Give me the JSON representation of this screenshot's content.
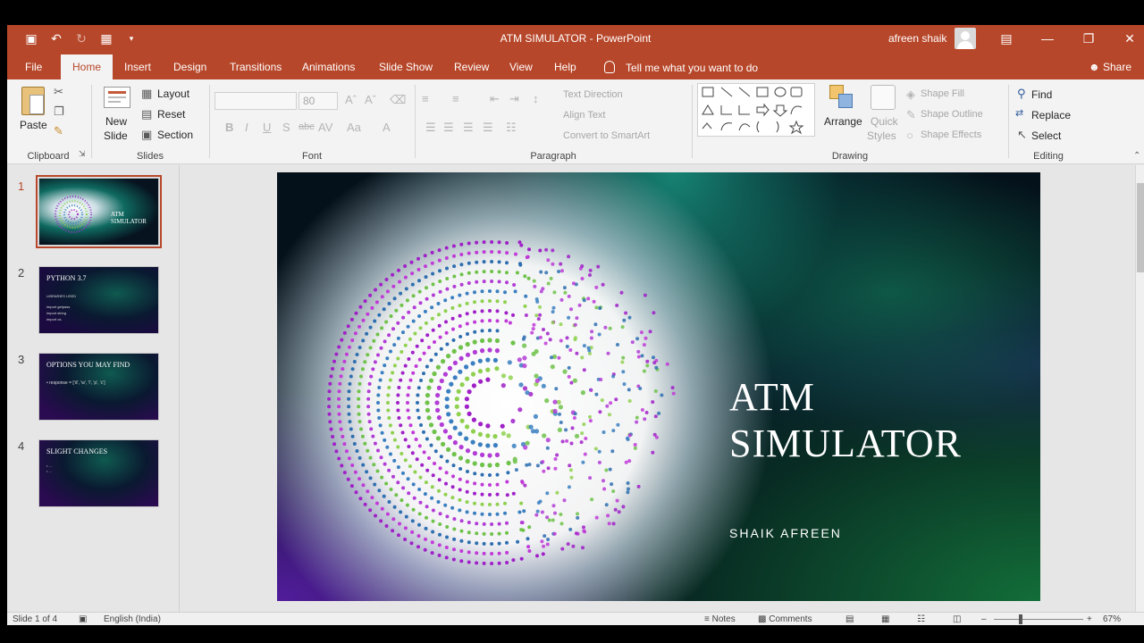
{
  "window": {
    "title": "ATM SIMULATOR  -  PowerPoint",
    "user": "afreen shaik",
    "accent": "#b7472a"
  },
  "qat": [
    "save-icon",
    "undo-icon",
    "redo-icon",
    "start-from-beginning-icon",
    "customize-icon"
  ],
  "tabs": [
    "File",
    "Home",
    "Insert",
    "Design",
    "Transitions",
    "Animations",
    "Slide Show",
    "Review",
    "View",
    "Help"
  ],
  "tell_me": "Tell me what you want to do",
  "share": "Share",
  "ribbon": {
    "clipboard": {
      "label": "Clipboard",
      "paste": "Paste"
    },
    "slides": {
      "label": "Slides",
      "new_slide_1": "New",
      "new_slide_2": "Slide",
      "layout": "Layout",
      "reset": "Reset",
      "section": "Section"
    },
    "font": {
      "label": "Font",
      "size": "80",
      "bold": "B",
      "italic": "I",
      "underline": "U",
      "shadow": "S",
      "strike": "abc",
      "spacing": "AV",
      "case": "Aa",
      "color": "A"
    },
    "paragraph": {
      "label": "Paragraph",
      "text_direction": "Text Direction",
      "align_text": "Align Text",
      "smartart": "Convert to SmartArt"
    },
    "drawing": {
      "label": "Drawing",
      "arrange": "Arrange",
      "quick_1": "Quick",
      "quick_2": "Styles",
      "shape_fill": "Shape Fill",
      "shape_outline": "Shape Outline",
      "shape_effects": "Shape Effects"
    },
    "editing": {
      "label": "Editing",
      "find": "Find",
      "replace": "Replace",
      "select": "Select"
    }
  },
  "thumbnails": [
    {
      "num": "1",
      "title": "ATM SIMULATOR"
    },
    {
      "num": "2",
      "title": "PYTHON 3.7",
      "lines": [
        "LIBRARIES USED",
        "import getpass",
        "import string",
        "import os"
      ]
    },
    {
      "num": "3",
      "title": "OPTIONS YOU MAY FIND",
      "lines": [
        "• response = ['d', 'w', 'l', 'p', 'c']"
      ]
    },
    {
      "num": "4",
      "title": "SLIGHT CHANGES",
      "lines": [
        "• ...",
        "• ..."
      ]
    }
  ],
  "slide": {
    "title_line1": "ATM",
    "title_line2": "SIMULATOR",
    "subtitle": "SHAIK AFREEN"
  },
  "status": {
    "slide_of": "Slide 1 of 4",
    "language": "English (India)",
    "notes": "Notes",
    "comments": "Comments",
    "zoom": "67%"
  }
}
